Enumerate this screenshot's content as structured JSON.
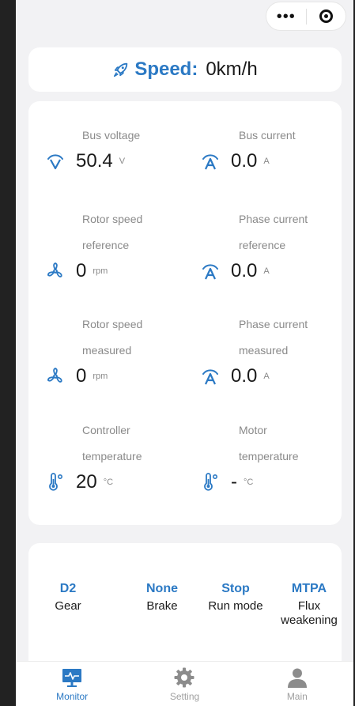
{
  "header": {
    "more_icon": "more-dots-icon",
    "close_icon": "target-icon"
  },
  "speed": {
    "label": "Speed:",
    "value": "0km/h",
    "icon": "rocket-icon"
  },
  "metrics": [
    {
      "label1": "Bus voltage",
      "label2": "",
      "value": "50.4",
      "unit": "V",
      "icon": "voltage-gauge-icon"
    },
    {
      "label1": "Bus current",
      "label2": "",
      "value": "0.0",
      "unit": "A",
      "icon": "current-gauge-icon"
    },
    {
      "label1": "Rotor speed",
      "label2": "reference",
      "value": "0",
      "unit": "rpm",
      "icon": "fan-icon"
    },
    {
      "label1": "Phase current",
      "label2": "reference",
      "value": "0.0",
      "unit": "A",
      "icon": "current-gauge-icon"
    },
    {
      "label1": "Rotor speed",
      "label2": "measured",
      "value": "0",
      "unit": "rpm",
      "icon": "fan-icon"
    },
    {
      "label1": "Phase current",
      "label2": "measured",
      "value": "0.0",
      "unit": "A",
      "icon": "current-gauge-icon"
    },
    {
      "label1": "Controller",
      "label2": "temperature",
      "value": "20",
      "unit": "°C",
      "icon": "thermometer-icon"
    },
    {
      "label1": "Motor",
      "label2": "temperature",
      "value": "-",
      "unit": "°C",
      "icon": "thermometer-icon"
    }
  ],
  "status": [
    {
      "value": "D2",
      "label": "Gear"
    },
    {
      "value": "None",
      "label": "Brake"
    },
    {
      "value": "Stop",
      "label": "Run mode"
    },
    {
      "value": "MTPA",
      "label": "Flux weakening"
    }
  ],
  "tabs": [
    {
      "label": "Monitor",
      "icon": "monitor-icon",
      "active": true
    },
    {
      "label": "Setting",
      "icon": "gear-icon",
      "active": false
    },
    {
      "label": "Main",
      "icon": "user-icon",
      "active": false
    }
  ],
  "colors": {
    "accent": "#2b79c4",
    "inactive": "#a0a0a0"
  }
}
